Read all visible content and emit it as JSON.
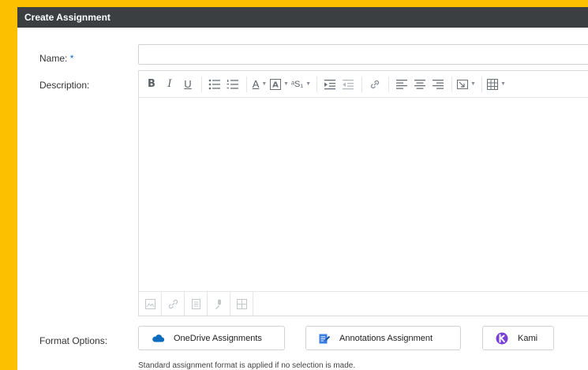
{
  "header": {
    "title": "Create Assignment"
  },
  "form": {
    "name_label": "Name:",
    "required_mark": "*",
    "name_value": "",
    "description_label": "Description:",
    "format_label": "Format Options:"
  },
  "format_options": [
    {
      "label": "OneDrive Assignments",
      "icon": "cloud-icon"
    },
    {
      "label": "Annotations Assignment",
      "icon": "annotation-icon"
    },
    {
      "label": "Kami",
      "icon": "kami-logo-icon"
    }
  ],
  "note": "Standard assignment format is applied if no selection is made.",
  "colors": {
    "background": "#fdc000",
    "header": "#3b3f42",
    "onedrive": "#0f6cbd",
    "kami": "#7a3fd6"
  }
}
